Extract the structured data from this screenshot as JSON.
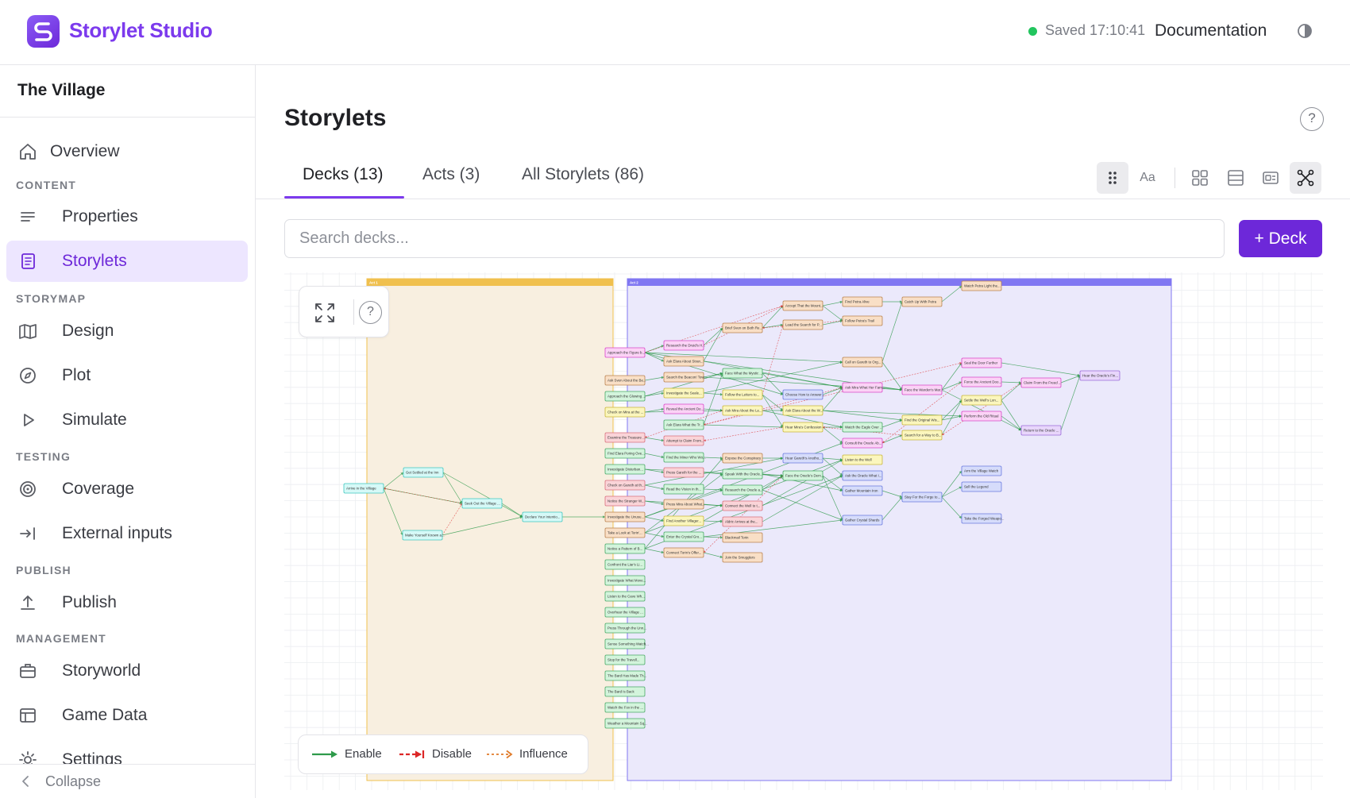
{
  "app": {
    "title": "Storylet Studio",
    "status": "Saved 17:10:41",
    "documentation_label": "Documentation"
  },
  "sidebar": {
    "world_name": "The Village",
    "overview": "Overview",
    "sections": {
      "content": "CONTENT",
      "storymap": "STORYMAP",
      "testing": "TESTING",
      "publish": "PUBLISH",
      "management": "MANAGEMENT"
    },
    "items": {
      "properties": "Properties",
      "storylets": "Storylets",
      "design": "Design",
      "plot": "Plot",
      "simulate": "Simulate",
      "coverage": "Coverage",
      "external_inputs": "External inputs",
      "publish": "Publish",
      "storyworld": "Storyworld",
      "game_data": "Game Data",
      "settings": "Settings"
    },
    "collapse": "Collapse"
  },
  "main": {
    "title": "Storylets",
    "help": "?",
    "tabs": [
      {
        "label": "Decks (13)"
      },
      {
        "label": "Acts (3)"
      },
      {
        "label": "All Storylets (86)"
      }
    ],
    "view_toggle_text": "Aa",
    "search_placeholder": "Search decks...",
    "add_deck_label": "+ Deck"
  },
  "graph": {
    "help": "?",
    "legend": {
      "enable": "Enable",
      "disable": "Disable",
      "influence": "Influence"
    },
    "colors": {
      "enable": "#2e9a4a",
      "disable": "#dc2626",
      "influence": "#e07b2a"
    },
    "acts": [
      {
        "label": "Act 1",
        "color": "#f0c04e",
        "fill": "#f8efe0"
      },
      {
        "label": "Act 2",
        "color": "#8077f2",
        "fill": "#ebe9fb"
      }
    ],
    "storylets": [
      {
        "id": "a1",
        "text": "Arrive in the Village",
        "color": "cyan"
      },
      {
        "id": "a2",
        "text": "Get Settled at the Inn",
        "color": "cyan"
      },
      {
        "id": "a3",
        "text": "Seek Out the Village ...",
        "color": "cyan"
      },
      {
        "id": "a4",
        "text": "Make Yourself Known a...",
        "color": "cyan"
      },
      {
        "id": "a5",
        "text": "Declare Your Intentio...",
        "color": "cyan"
      },
      {
        "id": "c1",
        "text": "Approach the Figure b...",
        "color": "magenta"
      },
      {
        "id": "c2",
        "text": "Ask Sven About the Be...",
        "color": "orange"
      },
      {
        "id": "c3",
        "text": "Approach the Glowing ...",
        "color": "green"
      },
      {
        "id": "c4",
        "text": "Check on Mira at the ...",
        "color": "yellow"
      },
      {
        "id": "c5",
        "text": "Examine the Treasure ...",
        "color": "red"
      },
      {
        "id": "c6",
        "text": "Find Elara Poring Ove...",
        "color": "green"
      },
      {
        "id": "c7",
        "text": "Investigate Disturban...",
        "color": "green"
      },
      {
        "id": "c8",
        "text": "Check on Gareth at th...",
        "color": "red"
      },
      {
        "id": "c9",
        "text": "Notice the Stranger W...",
        "color": "red"
      },
      {
        "id": "c10",
        "text": "Investigate the Unusu...",
        "color": "orange"
      },
      {
        "id": "c11",
        "text": "Take a Look at Torin'...",
        "color": "orange"
      },
      {
        "id": "c12",
        "text": "Notice a Pattern of B...",
        "color": "green"
      },
      {
        "id": "c13",
        "text": "Confront the Liar's Li...",
        "color": "green"
      },
      {
        "id": "c14",
        "text": "Investigate What Move...",
        "color": "green"
      },
      {
        "id": "c15",
        "text": "Listen to the Cave Wh...",
        "color": "green"
      },
      {
        "id": "c16",
        "text": "Overhear the Village ...",
        "color": "green"
      },
      {
        "id": "c17",
        "text": "Press Through the Unn...",
        "color": "green"
      },
      {
        "id": "c18",
        "text": "Sense Something Watch...",
        "color": "green"
      },
      {
        "id": "c19",
        "text": "Stop for the Travell...",
        "color": "green"
      },
      {
        "id": "c20",
        "text": "The Bard Has Made Th...",
        "color": "green"
      },
      {
        "id": "c21",
        "text": "The Bard Is Back",
        "color": "green"
      },
      {
        "id": "c22",
        "text": "Watch the Fox in the ...",
        "color": "green"
      },
      {
        "id": "c23",
        "text": "Weather a Mountain Sq...",
        "color": "green"
      },
      {
        "id": "d1",
        "text": "Research the Druid's H...",
        "color": "magenta"
      },
      {
        "id": "d2",
        "text": "Ask Elara About Stran...",
        "color": "orange"
      },
      {
        "id": "d3",
        "text": "Search the Beacon! Tow...",
        "color": "orange"
      },
      {
        "id": "d4",
        "text": "Investigate the Seale...",
        "color": "yellow"
      },
      {
        "id": "d5",
        "text": "Reveal the Ancient Do...",
        "color": "magenta"
      },
      {
        "id": "d6",
        "text": "Ask Elara What the Tr...",
        "color": "green"
      },
      {
        "id": "d7",
        "text": "Attempt to Claim From...",
        "color": "red"
      },
      {
        "id": "d8",
        "text": "Find the Miner Who Wo...",
        "color": "green"
      },
      {
        "id": "d9",
        "text": "Press Gareth for the ...",
        "color": "red"
      },
      {
        "id": "d10",
        "text": "Read the Vision in th...",
        "color": "green"
      },
      {
        "id": "d11",
        "text": "Press Mira About What...",
        "color": "orange"
      },
      {
        "id": "d12",
        "text": "Find Another Villager...",
        "color": "yellow"
      },
      {
        "id": "d13",
        "text": "Enter the Crystal Gro...",
        "color": "green"
      },
      {
        "id": "d14",
        "text": "Connect Torin's Offer...",
        "color": "orange"
      },
      {
        "id": "e1",
        "text": "Brief Sven on Both Re...",
        "color": "orange"
      },
      {
        "id": "e2",
        "text": "Face What the Mystic ...",
        "color": "green"
      },
      {
        "id": "e3",
        "text": "Follow the Letters to...",
        "color": "yellow"
      },
      {
        "id": "e4",
        "text": "Ask Mira About the Le...",
        "color": "yellow"
      },
      {
        "id": "e5",
        "text": "Expose the Conspiracy",
        "color": "orange"
      },
      {
        "id": "e6",
        "text": "Speak With the Oracle...",
        "color": "green"
      },
      {
        "id": "e7",
        "text": "Research the Oracle a...",
        "color": "green"
      },
      {
        "id": "e8",
        "text": "Connect the Well to t...",
        "color": "red"
      },
      {
        "id": "e9",
        "text": "Aldric Arrives at the...",
        "color": "red"
      },
      {
        "id": "e10",
        "text": "Blackmail Torin",
        "color": "orange"
      },
      {
        "id": "e11",
        "text": "Join the Smugglers",
        "color": "orange"
      },
      {
        "id": "f1",
        "text": "Accept That the Mount...",
        "color": "orange"
      },
      {
        "id": "f2",
        "text": "Lead the Search for P...",
        "color": "orange"
      },
      {
        "id": "f3",
        "text": "Choose How to Answer ...",
        "color": "blue"
      },
      {
        "id": "f4",
        "text": "Ask Elara About the W...",
        "color": "yellow"
      },
      {
        "id": "f5",
        "text": "Hear Mira's Confession",
        "color": "yellow"
      },
      {
        "id": "f6",
        "text": "Hear Gareth's Anotho...",
        "color": "blue"
      },
      {
        "id": "f7",
        "text": "Face the Oracle's Dem...",
        "color": "green"
      },
      {
        "id": "g1",
        "text": "Find Petra Alive",
        "color": "orange"
      },
      {
        "id": "g2",
        "text": "Follow Petra's Trail",
        "color": "orange"
      },
      {
        "id": "g3",
        "text": "Call on Gareth to Org...",
        "color": "orange"
      },
      {
        "id": "g4",
        "text": "Ask Mira What Her Fam...",
        "color": "magenta"
      },
      {
        "id": "g5",
        "text": "Watch the Eagle Over ...",
        "color": "green"
      },
      {
        "id": "g6",
        "text": "Consult the Oracle Ab...",
        "color": "magenta"
      },
      {
        "id": "g7",
        "text": "Listen to the Well",
        "color": "yellow"
      },
      {
        "id": "g8",
        "text": "Ask the Oracle What I...",
        "color": "blue"
      },
      {
        "id": "g9",
        "text": "Gather Mountain Iron",
        "color": "blue"
      },
      {
        "id": "g10",
        "text": "Gather Crystal Shards",
        "color": "blue"
      },
      {
        "id": "h1",
        "text": "Catch Up With Petra",
        "color": "orange"
      },
      {
        "id": "h2",
        "text": "Face the Warden's Mar...",
        "color": "magenta"
      },
      {
        "id": "h3",
        "text": "Find the Original Wis...",
        "color": "yellow"
      },
      {
        "id": "h4",
        "text": "Search for a Way to B...",
        "color": "yellow"
      },
      {
        "id": "h5",
        "text": "Stay For the Forge to...",
        "color": "blue"
      },
      {
        "id": "i1",
        "text": "Watch Petra Light the...",
        "color": "orange"
      },
      {
        "id": "i2",
        "text": "Seal the Door Further",
        "color": "magenta"
      },
      {
        "id": "i3",
        "text": "Force the Ancient Doo...",
        "color": "magenta"
      },
      {
        "id": "i4",
        "text": "Settle the Well's Lon...",
        "color": "yellow"
      },
      {
        "id": "i5",
        "text": "Perform the Old Ritual",
        "color": "magenta"
      },
      {
        "id": "i6",
        "text": "Arm the Village Watch",
        "color": "blue"
      },
      {
        "id": "i7",
        "text": "Sell the Legend",
        "color": "blue"
      },
      {
        "id": "i8",
        "text": "Take the Forged Weapo...",
        "color": "blue"
      },
      {
        "id": "j1",
        "text": "Claim From the Freed ...",
        "color": "magenta"
      },
      {
        "id": "j2",
        "text": "Return to the Oracle ...",
        "color": "purple"
      },
      {
        "id": "k1",
        "text": "Hear the Oracle's Fin...",
        "color": "purple"
      }
    ]
  }
}
